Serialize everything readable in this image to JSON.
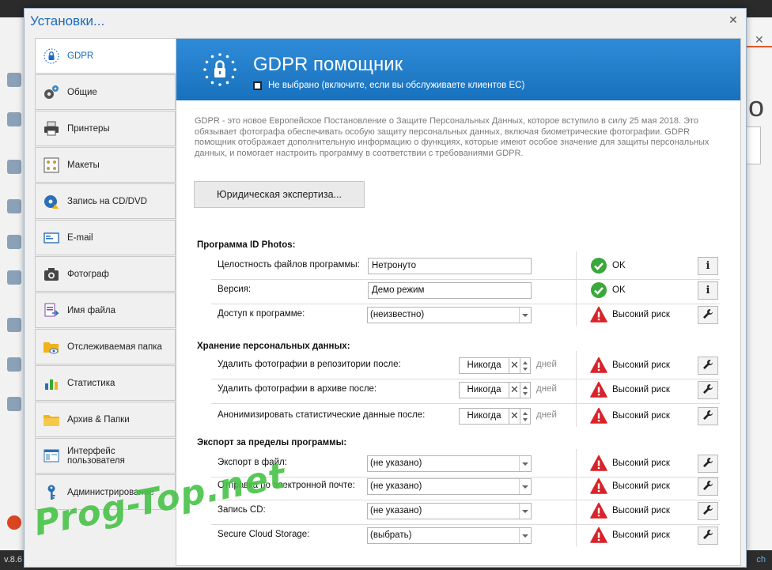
{
  "background": {
    "version_text": "v.8.6",
    "right_text": "ch"
  },
  "dialog": {
    "title": "Установки...",
    "close_glyph": "✕"
  },
  "nav": {
    "items": [
      {
        "label": "GDPR",
        "icon": "lock-badge-icon",
        "active": true
      },
      {
        "label": "Общие",
        "icon": "gears-icon"
      },
      {
        "label": "Принтеры",
        "icon": "printer-icon"
      },
      {
        "label": "Макеты",
        "icon": "layout-icon"
      },
      {
        "label": "Запись на CD/DVD",
        "icon": "disc-icon"
      },
      {
        "label": "E-mail",
        "icon": "email-icon"
      },
      {
        "label": "Фотограф",
        "icon": "camera-icon"
      },
      {
        "label": "Имя файла",
        "icon": "file-name-icon"
      },
      {
        "label": "Отслеживаемая папка",
        "icon": "watched-folder-icon"
      },
      {
        "label": "Статистика",
        "icon": "statistics-icon"
      },
      {
        "label": "Архив & Папки",
        "icon": "folder-icon"
      },
      {
        "label": "Интерфейс пользователя",
        "icon": "user-interface-icon"
      },
      {
        "label": "Администрирование",
        "icon": "key-icon"
      }
    ]
  },
  "banner": {
    "title": "GDPR помощник",
    "checkbox_label": "Не выбрано (включите, если вы обслуживаете клиентов ЕС)",
    "checked": false
  },
  "description": "GDPR - это новое Европейское Постановление о Защите Персональных Данных, которое вступило в силу 25 мая 2018. Это обязывает фотографа обеспечивать особую защиту персональных данных, включая биометрические фотографии. GDPR помощник отображает дополнительную информацию о функциях, которые имеют особое значение для защиты персональных данных, и помогает настроить программу в соответствии с требованиями GDPR.",
  "legal_button": "Юридическая экспертиза...",
  "sections": {
    "program": {
      "title": "Программа ID Photos:",
      "rows": [
        {
          "label": "Целостность файлов программы:",
          "value": "Нетронуто",
          "status": "OK"
        },
        {
          "label": "Версия:",
          "value": "Демо режим",
          "status": "OK"
        },
        {
          "label": "Доступ к программе:",
          "value": "(неизвестно)",
          "status": "Высокий риск"
        }
      ]
    },
    "storage": {
      "title": "Хранение персональных данных:",
      "unit": "дней",
      "clear_glyph": "✕",
      "rows": [
        {
          "label": "Удалить фотографии в репозитории после:",
          "value": "Никогда",
          "status": "Высокий риск"
        },
        {
          "label": "Удалить фотографии в архиве после:",
          "value": "Никогда",
          "status": "Высокий риск"
        },
        {
          "label": "Анонимизировать статистические данные после:",
          "value": "Никогда",
          "status": "Высокий риск"
        }
      ]
    },
    "export": {
      "title": "Экспорт за пределы программы:",
      "rows": [
        {
          "label": "Экспорт в файл:",
          "value": "(не указано)",
          "status": "Высокий риск"
        },
        {
          "label": "Отправка по электронной почте:",
          "value": "(не указано)",
          "status": "Высокий риск"
        },
        {
          "label": "Запись CD:",
          "value": "(не указано)",
          "status": "Высокий риск"
        },
        {
          "label": "Secure Cloud Storage:",
          "value": "(выбрать)",
          "status": "Высокий риск"
        }
      ]
    }
  },
  "watermark": "Prog-Top.net",
  "colors": {
    "accent": "#1b6ac0",
    "banner": "#1e78c6",
    "ok_green": "#3aa83a",
    "risk_red": "#d9232a"
  }
}
